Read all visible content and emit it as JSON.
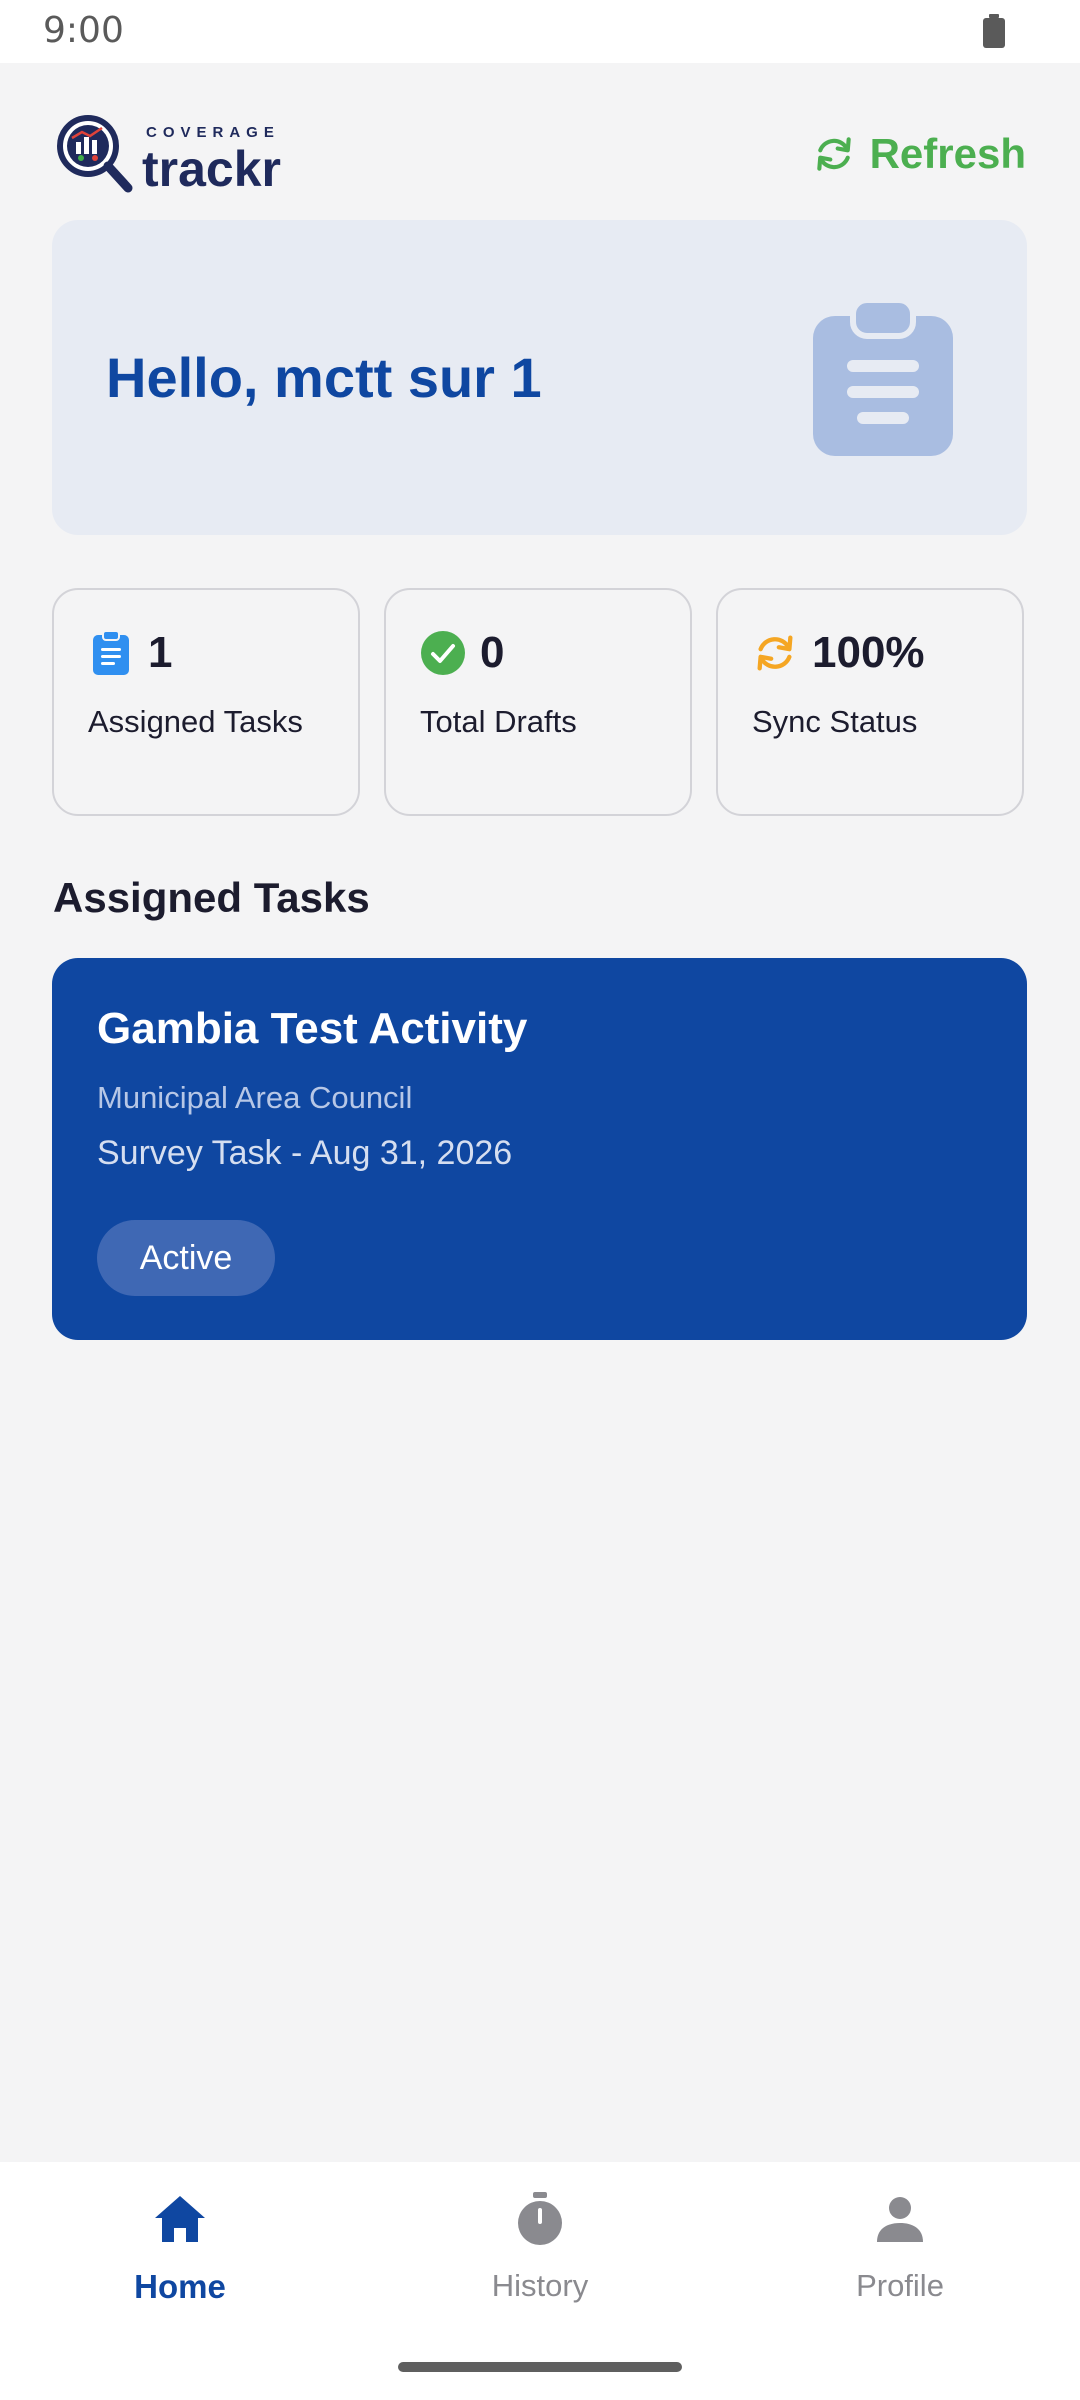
{
  "status_bar": {
    "time": "9:00"
  },
  "header": {
    "logo_small": "COVERAGE",
    "logo_big": "trackr",
    "refresh_label": "Refresh"
  },
  "greeting": {
    "text": "Hello, mctt sur 1"
  },
  "stats": [
    {
      "value": "1",
      "label": "Assigned Tasks",
      "icon": "clipboard-icon"
    },
    {
      "value": "0",
      "label": "Total Drafts",
      "icon": "check-circle-icon"
    },
    {
      "value": "100%",
      "label": "Sync Status",
      "icon": "sync-icon"
    }
  ],
  "assigned_section": {
    "title": "Assigned Tasks"
  },
  "tasks": [
    {
      "title": "Gambia Test Activity",
      "organization": "Municipal Area Council",
      "meta": "Survey Task - Aug 31, 2026",
      "status": "Active"
    }
  ],
  "nav": {
    "items": [
      {
        "label": "Home",
        "icon": "home-icon",
        "active": true
      },
      {
        "label": "History",
        "icon": "stopwatch-icon",
        "active": false
      },
      {
        "label": "Profile",
        "icon": "person-icon",
        "active": false
      }
    ]
  },
  "colors": {
    "primary": "#0f47a1",
    "accent_green": "#4caf50",
    "sync_orange": "#f5a623",
    "stat_blue": "#2f8ff0",
    "background": "#f4f4f5",
    "greeting_bg": "#e7ebf3"
  }
}
